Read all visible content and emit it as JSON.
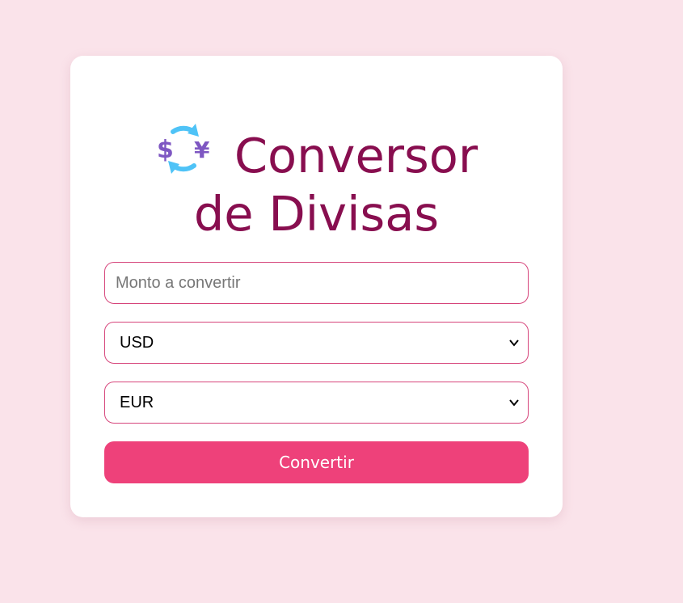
{
  "title": {
    "icon": "currency-exchange-icon",
    "line1": "Conversor",
    "line2": "de Divisas"
  },
  "amount_field": {
    "placeholder": "Monto a convertir",
    "value": ""
  },
  "from_currency": {
    "selected": "USD"
  },
  "to_currency": {
    "selected": "EUR"
  },
  "convert_button": {
    "label": "Convertir"
  },
  "colors": {
    "background": "#fae3ea",
    "title": "#880e4f",
    "border": "#d6457b",
    "button": "#ee417a"
  }
}
